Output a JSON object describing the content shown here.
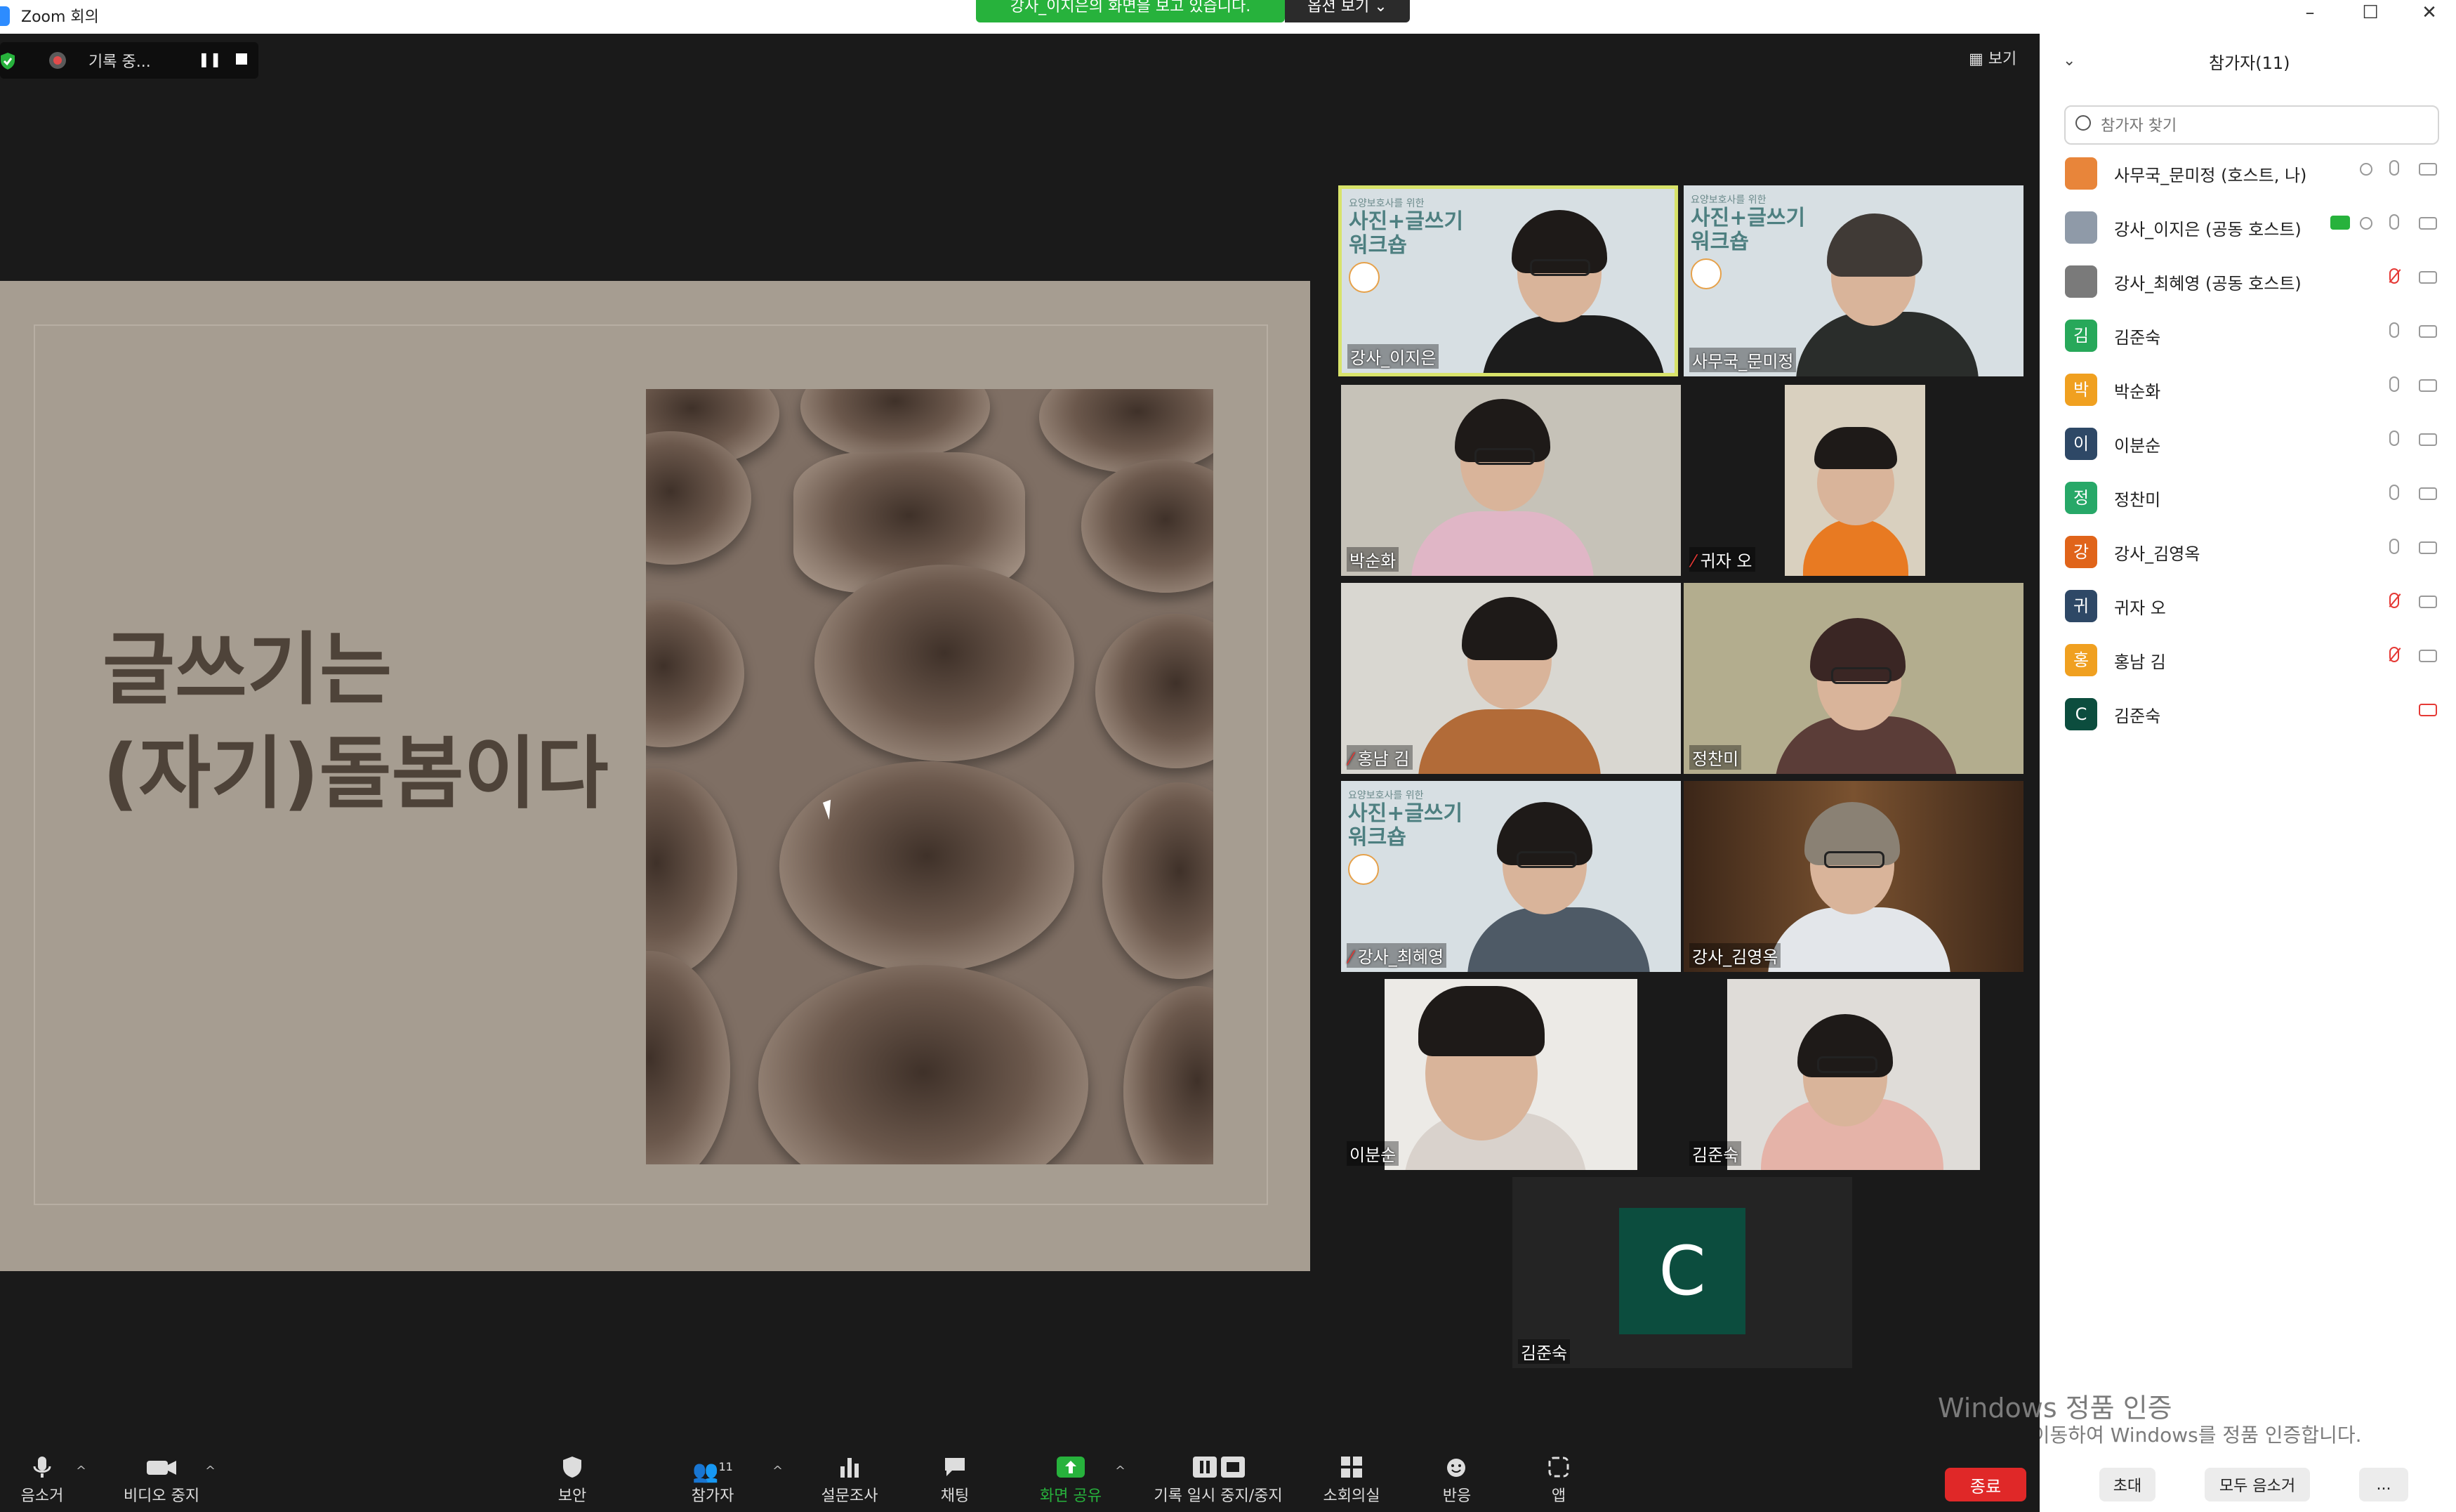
{
  "window": {
    "title": "Zoom 회의",
    "minimize": "–",
    "maximize": "☐",
    "close": "✕"
  },
  "share_banner": {
    "text": "강사_이지은의 화면을 보고 있습니다.",
    "view_options": "옵션 보기 ⌄"
  },
  "recording": {
    "label": "기록 중...",
    "pause": "❚❚"
  },
  "view_toggle": "▦ 보기",
  "slide": {
    "title": "글쓰기는\n(자기)돌봄이다"
  },
  "promo": {
    "line1": "요양보호사를 위한",
    "line2": "사진+글쓰기\n워크숍"
  },
  "tiles": [
    {
      "name": "강사_이지은",
      "muted": false
    },
    {
      "name": "사무국_문미정",
      "muted": false
    },
    {
      "name": "박순화",
      "muted": false
    },
    {
      "name": "귀자 오",
      "muted": true
    },
    {
      "name": "홍남 김",
      "muted": true
    },
    {
      "name": "정찬미",
      "muted": false
    },
    {
      "name": "강사_최혜영",
      "muted": true
    },
    {
      "name": "강사_김영옥",
      "muted": false
    },
    {
      "name": "이분순",
      "muted": false
    },
    {
      "name": "김준숙",
      "muted": false
    },
    {
      "name": "김준숙",
      "muted": false,
      "avatar_letter": "C"
    }
  ],
  "panel": {
    "title": "참가자(11)",
    "collapse": "⌄",
    "search_placeholder": "참가자 찾기",
    "participants": [
      {
        "name": "사무국_문미정 (호스트, 나)",
        "avatar": "",
        "color": "#e8853a",
        "mic": "on",
        "cam": "on",
        "rec": true
      },
      {
        "name": "강사_이지은 (공동 호스트)",
        "avatar": "",
        "color": "#8f9aa8",
        "mic": "on",
        "cam": "on",
        "rec": true,
        "sharing": true
      },
      {
        "name": "강사_최혜영 (공동 호스트)",
        "avatar": "",
        "color": "#7a7a7a",
        "mic": "off",
        "cam": "on"
      },
      {
        "name": "김준숙",
        "avatar": "김",
        "color": "#27a85a",
        "mic": "on",
        "cam": "on"
      },
      {
        "name": "박순화",
        "avatar": "박",
        "color": "#f0a020",
        "mic": "on",
        "cam": "on"
      },
      {
        "name": "이분순",
        "avatar": "이",
        "color": "#2e4866",
        "mic": "on",
        "cam": "on"
      },
      {
        "name": "정찬미",
        "avatar": "정",
        "color": "#27a868",
        "mic": "on",
        "cam": "on"
      },
      {
        "name": "강사_김영옥",
        "avatar": "강",
        "color": "#e0641a",
        "mic": "on",
        "cam": "on"
      },
      {
        "name": "귀자 오",
        "avatar": "귀",
        "color": "#2e4866",
        "mic": "off",
        "cam": "on"
      },
      {
        "name": "홍남 김",
        "avatar": "홍",
        "color": "#f0a020",
        "mic": "off",
        "cam": "on"
      },
      {
        "name": "김준숙",
        "avatar": "C",
        "color": "#0c4d3e",
        "mic": "none",
        "cam": "off"
      }
    ],
    "invite": "초대",
    "mute_all": "모두 음소거",
    "more": "..."
  },
  "watermark": {
    "line1": "Windows 정품 인증",
    "line2": "[설정]으로 이동하여 Windows를 정품 인증합니다."
  },
  "toolbar": {
    "mute": "음소거",
    "video_stop": "비디오 중지",
    "security": "보안",
    "participants": "참가자",
    "participants_count": "11",
    "polls": "설문조사",
    "chat": "채팅",
    "share_screen": "화면 공유",
    "pause_stop_recording": "기록 일시 중지/중지",
    "breakout_rooms": "소회의실",
    "reactions": "반응",
    "apps": "앱",
    "end": "종료"
  },
  "colors": {
    "share_green": "#27b23c",
    "end_red": "#e02828",
    "speaker_highlight": "#d8e36a"
  }
}
